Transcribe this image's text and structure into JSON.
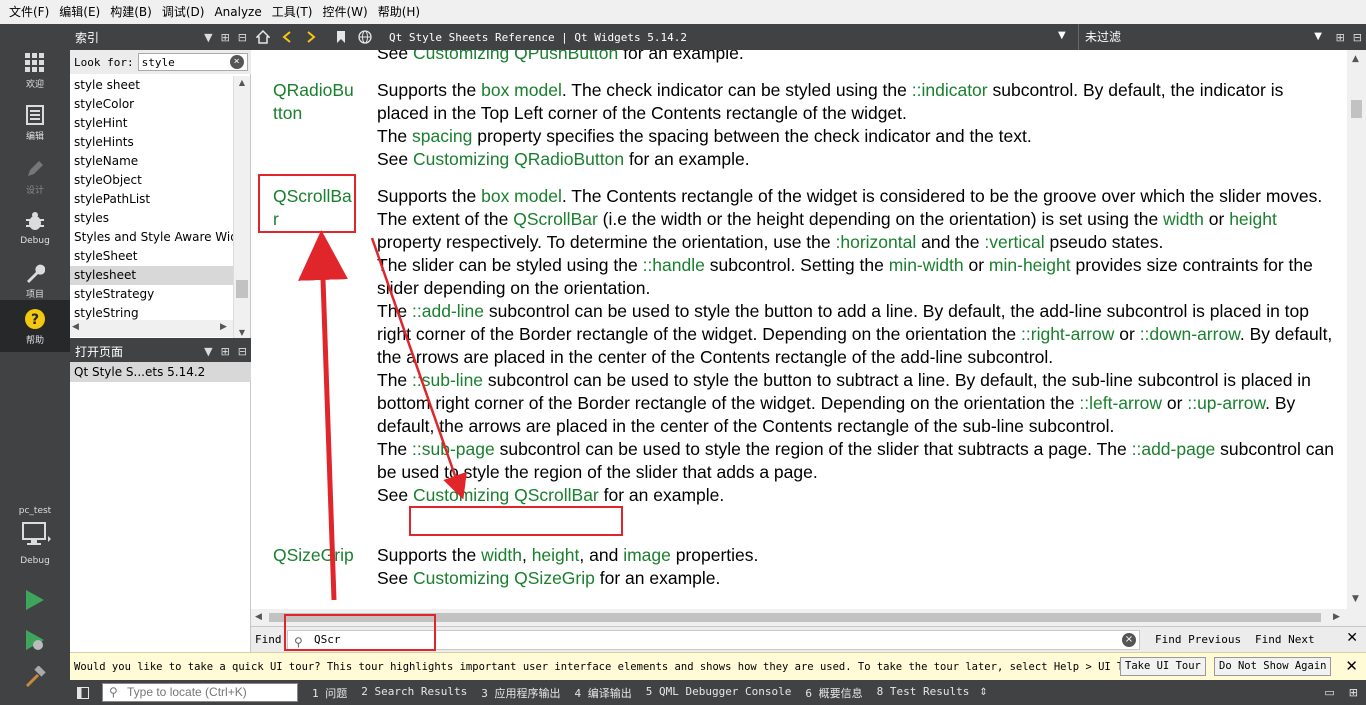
{
  "menu": [
    "文件(F)",
    "编辑(E)",
    "构建(B)",
    "调试(D)",
    "Analyze",
    "工具(T)",
    "控件(W)",
    "帮助(H)"
  ],
  "modes": [
    {
      "label": "欢迎",
      "icon": "grid-icon"
    },
    {
      "label": "编辑",
      "icon": "document-icon"
    },
    {
      "label": "设计",
      "icon": "pencil-icon"
    },
    {
      "label": "Debug",
      "icon": "bug-icon"
    },
    {
      "label": "项目",
      "icon": "wrench-icon"
    },
    {
      "label": "帮助",
      "icon": "help-icon"
    }
  ],
  "kit": {
    "project": "pc_test",
    "mode": "Debug"
  },
  "index_panel": {
    "title": "索引",
    "look_for_label": "Look for:",
    "look_for_value": "style",
    "items": [
      "style sheet",
      "styleColor",
      "styleHint",
      "styleHints",
      "styleName",
      "styleObject",
      "stylePathList",
      "styles",
      "Styles and Style Aware Widg",
      "styleSheet",
      "stylesheet",
      "styleStrategy",
      "styleString"
    ],
    "selected_index": 10
  },
  "open_pages": {
    "title": "打开页面",
    "items": [
      "Qt Style S...ets 5.14.2"
    ]
  },
  "doc_toolbar": {
    "title": "Qt Style Sheets Reference | Qt Widgets 5.14.2",
    "filter": "未过滤"
  },
  "doc": {
    "top_partial": {
      "pre": "See ",
      "link": "Customizing QPushButton",
      "post": " for an example."
    },
    "entries": [
      {
        "key": "QRadioButton",
        "lines": [
          [
            {
              "t": "Supports the "
            },
            {
              "l": "box model"
            },
            {
              "t": ". The check indicator can be styled using the "
            },
            {
              "l": "::indicator"
            },
            {
              "t": " subcontrol. By default, the indicator is placed in the Top Left corner of the Contents rectangle of the widget."
            }
          ],
          [
            {
              "t": "The "
            },
            {
              "l": "spacing"
            },
            {
              "t": " property specifies the spacing between the check indicator and the text."
            }
          ],
          [
            {
              "t": "See "
            },
            {
              "l": "Customizing QRadioButton"
            },
            {
              "t": " for an example."
            }
          ]
        ]
      },
      {
        "key": "QScrollBar",
        "lines": [
          [
            {
              "t": "Supports the "
            },
            {
              "l": "box model"
            },
            {
              "t": ". The Contents rectangle of the widget is considered to be the groove over which the slider moves. The extent of the "
            },
            {
              "l": "QScrollBar"
            },
            {
              "t": " (i.e the width or the height depending on the orientation) is set using the "
            },
            {
              "l": "width"
            },
            {
              "t": " or "
            },
            {
              "l": "height"
            },
            {
              "t": " property respectively. To determine the orientation, use the "
            },
            {
              "l": ":horizontal"
            },
            {
              "t": " and the "
            },
            {
              "l": ":vertical"
            },
            {
              "t": " pseudo states."
            }
          ],
          [
            {
              "t": "The slider can be styled using the "
            },
            {
              "l": "::handle"
            },
            {
              "t": " subcontrol. Setting the "
            },
            {
              "l": "min-width"
            },
            {
              "t": " or "
            },
            {
              "l": "min-height"
            },
            {
              "t": " provides size contraints for the slider depending on the orientation."
            }
          ],
          [
            {
              "t": "The "
            },
            {
              "l": "::add-line"
            },
            {
              "t": " subcontrol can be used to style the button to add a line. By default, the add-line subcontrol is placed in top right corner of the Border rectangle of the widget. Depending on the orientation the "
            },
            {
              "l": "::right-arrow"
            },
            {
              "t": " or "
            },
            {
              "l": "::down-arrow"
            },
            {
              "t": ". By default, the arrows are placed in the center of the Contents rectangle of the add-line subcontrol."
            }
          ],
          [
            {
              "t": "The "
            },
            {
              "l": "::sub-line"
            },
            {
              "t": " subcontrol can be used to style the button to subtract a line. By default, the sub-line subcontrol is placed in bottom right corner of the Border rectangle of the widget. Depending on the orientation the "
            },
            {
              "l": "::left-arrow"
            },
            {
              "t": " or "
            },
            {
              "l": "::up-arrow"
            },
            {
              "t": ". By default, the arrows are placed in the center of the Contents rectangle of the sub-line subcontrol."
            }
          ],
          [
            {
              "t": "The "
            },
            {
              "l": "::sub-page"
            },
            {
              "t": " subcontrol can be used to style the region of the slider that subtracts a page. The "
            },
            {
              "l": "::add-page"
            },
            {
              "t": " subcontrol can be used to style the region of the slider that adds a page."
            }
          ],
          [
            {
              "t": "See "
            },
            {
              "l": "Customizing QScrollBar"
            },
            {
              "t": " for an example."
            }
          ]
        ]
      },
      {
        "key": "QSizeGrip",
        "lines": [
          [
            {
              "t": "Supports the "
            },
            {
              "l": "width"
            },
            {
              "t": ", "
            },
            {
              "l": "height"
            },
            {
              "t": ", and "
            },
            {
              "l": "image"
            },
            {
              "t": " properties."
            }
          ],
          [
            {
              "t": "See "
            },
            {
              "l": "Customizing QSizeGrip"
            },
            {
              "t": " for an example."
            }
          ]
        ]
      }
    ]
  },
  "find_bar": {
    "label": "Find:",
    "value": "QScr",
    "find_previous": "Find Previous",
    "find_next": "Find Next"
  },
  "tour_bar": {
    "message": "Would you like to take a quick UI tour? This tour highlights important user interface elements and shows how they are used. To take the tour later, select Help > UI Tour.",
    "take_tour": "Take UI Tour",
    "dont_show": "Do Not Show Again"
  },
  "status_bar": {
    "locator_placeholder": "Type to locate (Ctrl+K)",
    "tabs": [
      "1 问题",
      "2 Search Results",
      "3 应用程序输出",
      "4 编译输出",
      "5 QML Debugger Console",
      "6 概要信息",
      "8 Test Results"
    ]
  },
  "colors": {
    "link": "#1a7f2e",
    "annotation": "#e0262b",
    "dark_panel": "#404244"
  }
}
